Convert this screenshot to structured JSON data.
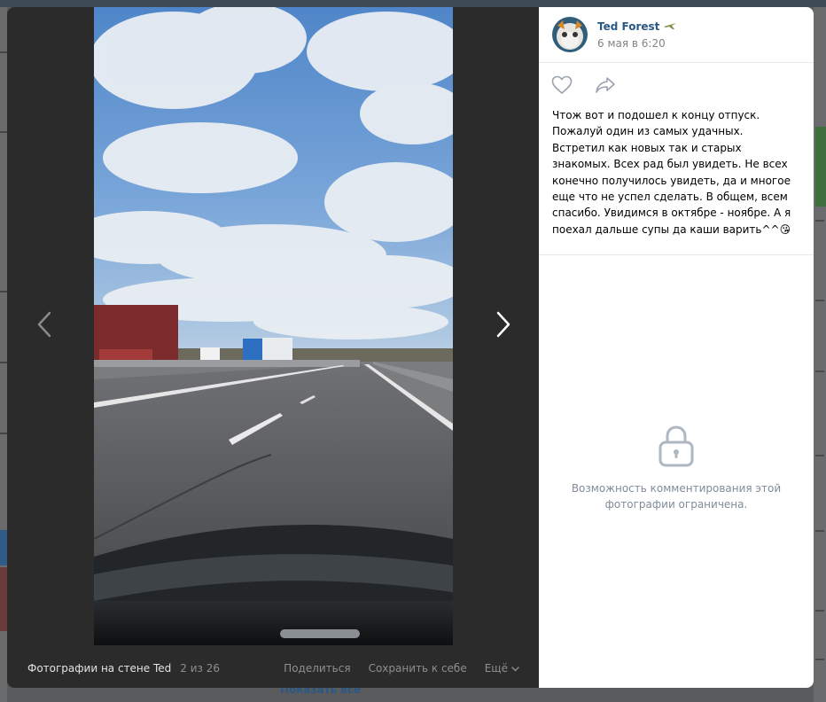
{
  "background": {
    "bottom_link": "Показать все"
  },
  "viewer": {
    "album_title": "Фотографии на стене Ted",
    "counter": "2 из 26",
    "share_label": "Поделиться",
    "save_label": "Сохранить к себе",
    "more_label": "Ещё"
  },
  "post": {
    "author_name": "Ted Forest",
    "date": "6 мая в 6:20",
    "text": "Чтож вот и подошел к концу отпуск. Пожалуй один из самых удачных. Встретил как новых так и старых знакомых. Всех рад был увидеть. Не всех конечно получилось увидеть, да и многое еще что не успел сделать. В общем, всем спасибо. Увидимся в октябре - ноябре. А я поехал дальше супы да каши варить^^😘"
  },
  "comments": {
    "restricted_text": "Возможность комментирования этой фотографии ограничена."
  },
  "colors": {
    "link_blue": "#2a5885",
    "muted_grey": "#818c99",
    "viewer_bg": "#2b2b2b"
  },
  "icons": {
    "prev": "chevron-left-icon",
    "next": "chevron-right-icon",
    "like": "heart-icon",
    "share": "share-arrow-icon",
    "lock": "lock-icon",
    "more": "chevron-down-icon",
    "badge": "airplane-icon"
  }
}
